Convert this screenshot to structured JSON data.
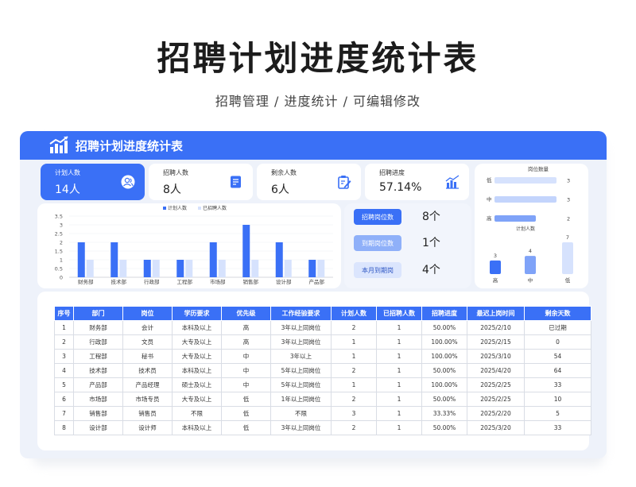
{
  "hero": {
    "title": "招聘计划进度统计表",
    "subtitle": "招聘管理 /  进度统计  /  可编辑修改"
  },
  "card": {
    "title": "招聘计划进度统计表",
    "header_icon": "bar-chart-trend-icon"
  },
  "stats": [
    {
      "label": "计划人数",
      "value": "14人",
      "icon": "people-icon"
    },
    {
      "label": "招聘人数",
      "value": "8人",
      "icon": "document-list-icon"
    },
    {
      "label": "剩余人数",
      "value": "6人",
      "icon": "clipboard-edit-icon"
    },
    {
      "label": "招聘进度",
      "value": "57.14%",
      "icon": "bar-chart-icon"
    }
  ],
  "tags": [
    {
      "label": "招聘岗位数",
      "value": "8个",
      "color": "#3a70f6"
    },
    {
      "label": "到期岗位数",
      "value": "1个",
      "color": "#8fb0f9"
    },
    {
      "label": "本月到期岗",
      "value": "4个",
      "color": "#dbe5fd"
    }
  ],
  "colors": {
    "accent": "#3a70f6",
    "mid": "#7fa3f8",
    "light": "#d6e2fd"
  },
  "chart_data": [
    {
      "type": "bar",
      "categories": [
        "财务部",
        "技术部",
        "行政部",
        "工程部",
        "市场部",
        "销售部",
        "设计部",
        "产品部"
      ],
      "series": [
        {
          "name": "计划人数",
          "values": [
            2,
            2,
            1,
            1,
            2,
            3,
            2,
            1
          ]
        },
        {
          "name": "已招聘人数",
          "values": [
            1,
            1,
            1,
            1,
            1,
            1,
            1,
            1
          ]
        }
      ],
      "yticks": [
        "0",
        "0.5",
        "1",
        "1.5",
        "2",
        "2.5",
        "3",
        "3.5"
      ],
      "ylim": [
        0,
        3.5
      ],
      "legend": "top-center"
    },
    {
      "type": "bar",
      "orientation": "horizontal",
      "title": "岗位数量",
      "categories": [
        "低",
        "中",
        "高"
      ],
      "values": [
        3,
        3,
        2
      ],
      "xlim": [
        0,
        3
      ]
    },
    {
      "type": "bar",
      "title": "计划人数",
      "categories": [
        "高",
        "中",
        "低"
      ],
      "values": [
        3,
        4,
        7
      ],
      "ylim": [
        0,
        7
      ]
    }
  ],
  "table": {
    "headers": [
      "序号",
      "部门",
      "岗位",
      "学历要求",
      "优先级",
      "工作经验要求",
      "计划人数",
      "已招聘人数",
      "招聘进度",
      "最迟上岗时间",
      "剩余天数"
    ],
    "rows": [
      [
        "1",
        "财务部",
        "会计",
        "本科及以上",
        "高",
        "3年以上同岗位",
        "2",
        "1",
        "50.00%",
        "2025/2/10",
        "已过期"
      ],
      [
        "2",
        "行政部",
        "文员",
        "大专及以上",
        "高",
        "3年以上同岗位",
        "1",
        "1",
        "100.00%",
        "2025/2/15",
        "0"
      ],
      [
        "3",
        "工程部",
        "秘书",
        "大专及以上",
        "中",
        "3年以上",
        "1",
        "1",
        "100.00%",
        "2025/3/10",
        "54"
      ],
      [
        "4",
        "技术部",
        "技术员",
        "本科及以上",
        "中",
        "5年以上同岗位",
        "2",
        "1",
        "50.00%",
        "2025/4/20",
        "64"
      ],
      [
        "5",
        "产品部",
        "产品经理",
        "硕士及以上",
        "中",
        "5年以上同岗位",
        "1",
        "1",
        "100.00%",
        "2025/2/25",
        "33"
      ],
      [
        "6",
        "市场部",
        "市场专员",
        "大专及以上",
        "低",
        "1年以上同岗位",
        "2",
        "1",
        "50.00%",
        "2025/2/25",
        "10"
      ],
      [
        "7",
        "销售部",
        "销售员",
        "不限",
        "低",
        "不限",
        "3",
        "1",
        "33.33%",
        "2025/2/20",
        "5"
      ],
      [
        "8",
        "设计部",
        "设计师",
        "本科及以上",
        "低",
        "3年以上同岗位",
        "2",
        "1",
        "50.00%",
        "2025/3/20",
        "33"
      ]
    ]
  }
}
